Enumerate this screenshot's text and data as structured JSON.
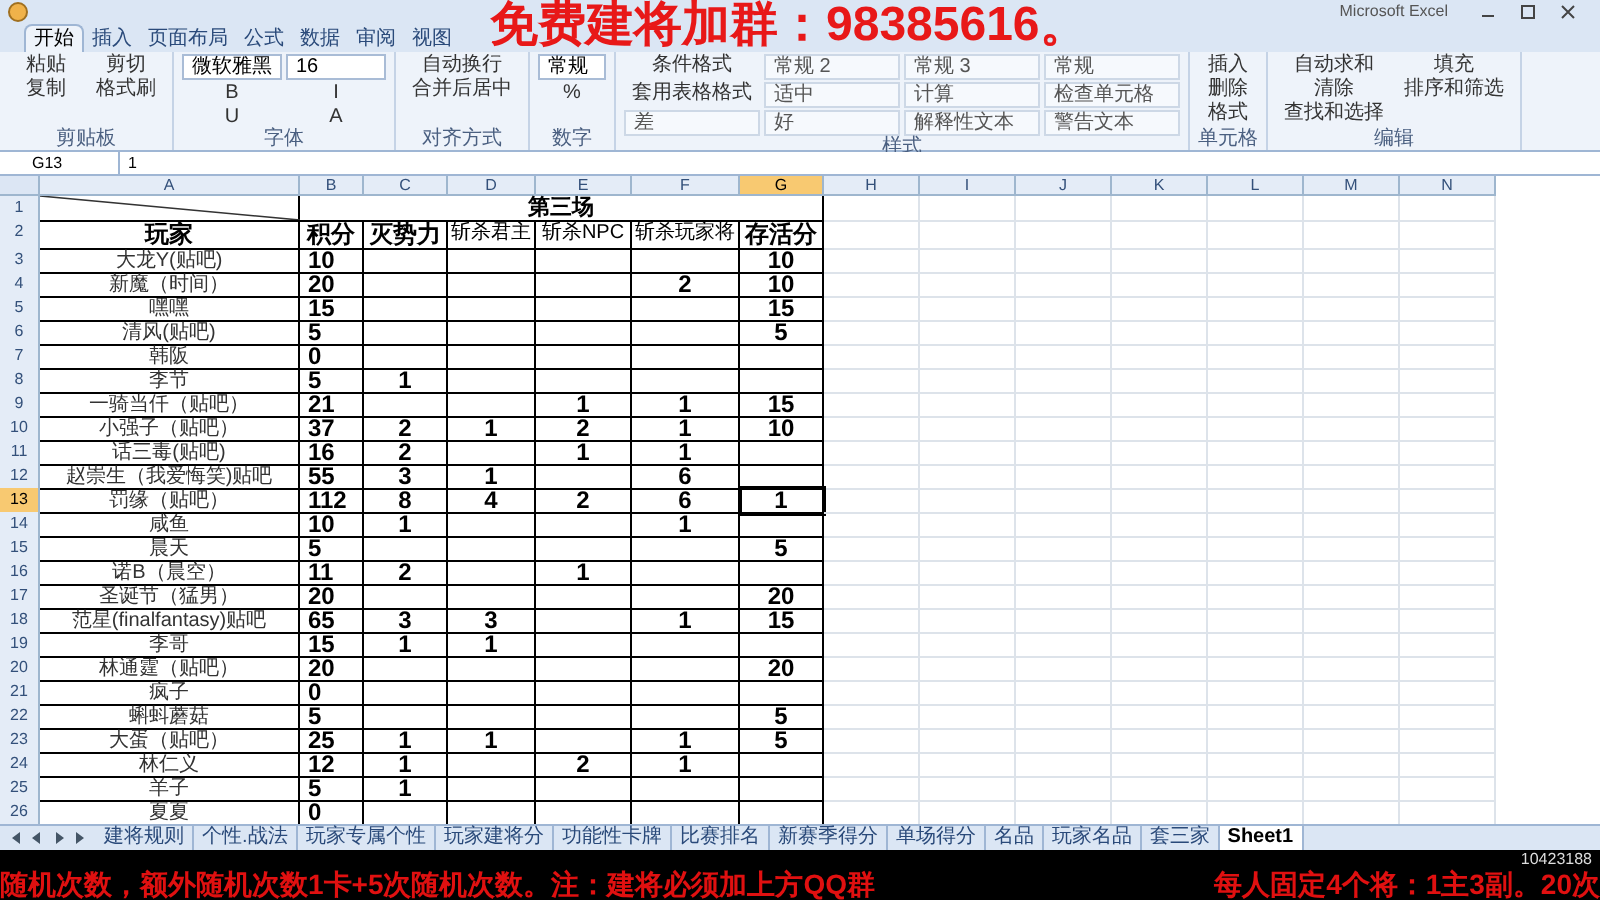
{
  "window": {
    "title": "Microsoft Excel"
  },
  "overlay_top": "免费建将加群：98385616。",
  "ribbon": {
    "tabs": [
      {
        "label": "开始",
        "selected": true
      },
      {
        "label": "插入",
        "selected": false
      },
      {
        "label": "页面布局",
        "selected": false
      },
      {
        "label": "公式",
        "selected": false
      },
      {
        "label": "数据",
        "selected": false
      },
      {
        "label": "审阅",
        "selected": false
      },
      {
        "label": "视图",
        "selected": false
      }
    ],
    "groups": [
      {
        "label": "剪贴板",
        "items": [
          {
            "kind": "button",
            "label": "粘贴"
          },
          {
            "kind": "button",
            "label": "剪切"
          },
          {
            "kind": "button",
            "label": "复制"
          },
          {
            "kind": "button",
            "label": "格式刷"
          }
        ]
      },
      {
        "label": "字体",
        "items": [
          {
            "kind": "field",
            "label": "微软雅黑"
          },
          {
            "kind": "field",
            "label": "16"
          },
          {
            "kind": "button",
            "label": "B"
          },
          {
            "kind": "button",
            "label": "I"
          },
          {
            "kind": "button",
            "label": "U"
          },
          {
            "kind": "button",
            "label": "A"
          }
        ]
      },
      {
        "label": "对齐方式",
        "items": [
          {
            "kind": "button",
            "label": "自动换行"
          },
          {
            "kind": "button",
            "label": "合并后居中"
          }
        ]
      },
      {
        "label": "数字",
        "items": [
          {
            "kind": "field",
            "label": "常规"
          },
          {
            "kind": "button",
            "label": "%"
          }
        ]
      },
      {
        "label": "样式",
        "items": [
          {
            "kind": "button",
            "label": "条件格式"
          },
          {
            "kind": "style",
            "label": "常规 2"
          },
          {
            "kind": "style",
            "label": "常规 3"
          },
          {
            "kind": "style",
            "label": "常规"
          },
          {
            "kind": "button",
            "label": "套用表格格式"
          },
          {
            "kind": "style",
            "label": "适中"
          },
          {
            "kind": "style",
            "label": "计算"
          },
          {
            "kind": "style",
            "label": "检查单元格"
          },
          {
            "kind": "style",
            "label": "差"
          },
          {
            "kind": "style",
            "label": "好"
          },
          {
            "kind": "style",
            "label": "解释性文本"
          },
          {
            "kind": "style",
            "label": "警告文本"
          }
        ]
      },
      {
        "label": "单元格",
        "items": [
          {
            "kind": "button",
            "label": "插入"
          },
          {
            "kind": "button",
            "label": "删除"
          },
          {
            "kind": "button",
            "label": "格式"
          }
        ]
      },
      {
        "label": "编辑",
        "items": [
          {
            "kind": "button",
            "label": "自动求和"
          },
          {
            "kind": "button",
            "label": "填充"
          },
          {
            "kind": "button",
            "label": "清除"
          },
          {
            "kind": "button",
            "label": "排序和筛选"
          },
          {
            "kind": "button",
            "label": "查找和选择"
          }
        ]
      }
    ]
  },
  "formula_bar": {
    "cell": "G13",
    "value": "1"
  },
  "sheet": {
    "columns": [
      {
        "label": "A",
        "selected": false
      },
      {
        "label": "B",
        "selected": false
      },
      {
        "label": "C",
        "selected": false
      },
      {
        "label": "D",
        "selected": false
      },
      {
        "label": "E",
        "selected": false
      },
      {
        "label": "F",
        "selected": false
      },
      {
        "label": "G",
        "selected": true
      },
      {
        "label": "H",
        "selected": false
      },
      {
        "label": "I",
        "selected": false
      },
      {
        "label": "J",
        "selected": false
      },
      {
        "label": "K",
        "selected": false
      },
      {
        "label": "L",
        "selected": false
      },
      {
        "label": "M",
        "selected": false
      },
      {
        "label": "N",
        "selected": false
      }
    ],
    "title_row": {
      "number": "1",
      "selected": false,
      "title": "第三场"
    },
    "header_row": {
      "number": "2",
      "selected": false,
      "player": "玩家",
      "headings": [
        {
          "text": "积分",
          "kind": "large"
        },
        {
          "text": "灭势力",
          "kind": "large"
        },
        {
          "text": "斩杀君主",
          "kind": "small"
        },
        {
          "text": "斩杀NPC",
          "kind": "small"
        },
        {
          "text": "斩杀玩家将",
          "kind": "small"
        },
        {
          "text": "存活分",
          "kind": "large"
        }
      ]
    },
    "rows": [
      {
        "number": "3",
        "selected": false,
        "player": "大龙Y(贴吧)",
        "cells": {
          "B": "10",
          "G": "10"
        }
      },
      {
        "number": "4",
        "selected": false,
        "player": "新魔（时间）",
        "cells": {
          "B": "20",
          "F": "2",
          "G": "10"
        }
      },
      {
        "number": "5",
        "selected": false,
        "player": "嘿嘿",
        "cells": {
          "B": "15",
          "G": "15"
        }
      },
      {
        "number": "6",
        "selected": false,
        "player": "清风(贴吧)",
        "cells": {
          "B": "5",
          "G": "5"
        }
      },
      {
        "number": "7",
        "selected": false,
        "player": "韩阪",
        "cells": {
          "B": "0"
        }
      },
      {
        "number": "8",
        "selected": false,
        "player": "李节",
        "cells": {
          "B": "5",
          "C": "1"
        }
      },
      {
        "number": "9",
        "selected": false,
        "player": "一骑当仟（贴吧）",
        "cells": {
          "B": "21",
          "E": "1",
          "F": "1",
          "G": "15"
        }
      },
      {
        "number": "10",
        "selected": false,
        "player": "小强子（贴吧）",
        "cells": {
          "B": "37",
          "C": "2",
          "D": "1",
          "E": "2",
          "F": "1",
          "G": "10"
        }
      },
      {
        "number": "11",
        "selected": false,
        "player": "话三毒(贴吧)",
        "cells": {
          "B": "16",
          "C": "2",
          "E": "1",
          "F": "1"
        }
      },
      {
        "number": "12",
        "selected": false,
        "player": "赵崇生（我爱悔笑)贴吧",
        "cells": {
          "B": "55",
          "C": "3",
          "D": "1",
          "F": "6"
        }
      },
      {
        "number": "13",
        "selected": true,
        "player": "罚缘（贴吧）",
        "cells": {
          "B": "112",
          "C": "8",
          "D": "4",
          "E": "2",
          "F": "6",
          "G": "1"
        }
      },
      {
        "number": "14",
        "selected": false,
        "player": "咸鱼",
        "cells": {
          "B": "10",
          "C": "1",
          "F": "1"
        }
      },
      {
        "number": "15",
        "selected": false,
        "player": "晨天",
        "cells": {
          "B": "5",
          "G": "5"
        }
      },
      {
        "number": "16",
        "selected": false,
        "player": "诺B（晨空）",
        "cells": {
          "B": "11",
          "C": "2",
          "E": "1"
        }
      },
      {
        "number": "17",
        "selected": false,
        "player": "圣诞节（猛男）",
        "cells": {
          "B": "20",
          "G": "20"
        }
      },
      {
        "number": "18",
        "selected": false,
        "player": "范星(finalfantasy)贴吧",
        "cells": {
          "B": "65",
          "C": "3",
          "D": "3",
          "F": "1",
          "G": "15"
        }
      },
      {
        "number": "19",
        "selected": false,
        "player": "李哥",
        "cells": {
          "B": "15",
          "C": "1",
          "D": "1"
        }
      },
      {
        "number": "20",
        "selected": false,
        "player": "林通霆（贴吧）",
        "cells": {
          "B": "20",
          "G": "20"
        }
      },
      {
        "number": "21",
        "selected": false,
        "player": "疯子",
        "cells": {
          "B": "0"
        }
      },
      {
        "number": "22",
        "selected": false,
        "player": "蝌蚪蘑菇",
        "cells": {
          "B": "5",
          "G": "5"
        }
      },
      {
        "number": "23",
        "selected": false,
        "player": "大蛋（贴吧）",
        "cells": {
          "B": "25",
          "C": "1",
          "D": "1",
          "F": "1",
          "G": "5"
        }
      },
      {
        "number": "24",
        "selected": false,
        "player": "林仁义",
        "cells": {
          "B": "12",
          "C": "1",
          "E": "2",
          "F": "1"
        }
      },
      {
        "number": "25",
        "selected": false,
        "player": "羊子",
        "cells": {
          "B": "5",
          "C": "1"
        }
      },
      {
        "number": "26",
        "selected": false,
        "player": "夏夏",
        "cells": {
          "B": "0"
        }
      }
    ]
  },
  "sheet_tabs": [
    {
      "label": "建将规则",
      "selected": false
    },
    {
      "label": "个性.战法",
      "selected": false
    },
    {
      "label": "玩家专属个性",
      "selected": false
    },
    {
      "label": "玩家建将分",
      "selected": false
    },
    {
      "label": "功能性卡牌",
      "selected": false
    },
    {
      "label": "比赛排名",
      "selected": false
    },
    {
      "label": "新赛季得分",
      "selected": false
    },
    {
      "label": "单场得分",
      "selected": false
    },
    {
      "label": "名品",
      "selected": false
    },
    {
      "label": "玩家名品",
      "selected": false
    },
    {
      "label": "套三家",
      "selected": false
    },
    {
      "label": "Sheet1",
      "selected": true
    }
  ],
  "overlay_bottom": {
    "left": "随机次数，额外随机次数1卡+5次随机次数。注：建将必须加上方QQ群",
    "right": "每人固定4个将：1主3副。20次",
    "counter": "10423188"
  }
}
